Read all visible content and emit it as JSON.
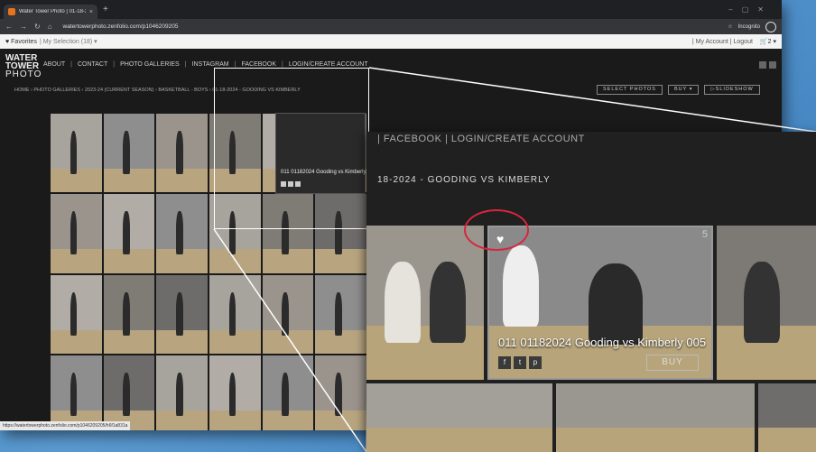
{
  "browser": {
    "tab_title": "Water Tower Photo | 01-18-2",
    "url": "watertowerphoto.zenfolio.com/p1046209205",
    "incognito_label": "Incognito",
    "new_tab": "+",
    "close": "×"
  },
  "favbar": {
    "label": "Favorites",
    "selection": "| My Selection (18) ▾",
    "account": "| My Account | Logout",
    "cart": "🛒2 ▾"
  },
  "site": {
    "logo": [
      "WATER",
      "TOWER",
      "PHOTO"
    ],
    "nav": [
      "ABOUT",
      "|",
      "CONTACT",
      "|",
      "PHOTO GALLERIES",
      "|",
      "INSTAGRAM",
      "|",
      "FACEBOOK",
      "|",
      "LOGIN/CREATE ACCOUNT"
    ],
    "breadcrumb": "HOME › PHOTO GALLERIES › 2023-24 (CURRENT SEASON) › BASKETBALL - BOYS › 01-18-2024 - GOODING VS KIMBERLY",
    "select_photos": "SELECT PHOTOS",
    "buy": "BUY ▾",
    "slideshow": "▷SLIDESHOW",
    "status_url": "https://watertowerphoto.zenfolio.com/p1046209205/h6f1a831a"
  },
  "hover": {
    "caption": "011 01182024 Gooding vs Kimberly",
    "icons": [
      "f",
      "t",
      "p"
    ]
  },
  "zoom": {
    "nav": "| FACEBOOK | LOGIN/CREATE ACCOUNT",
    "title": "18-2024 - GOODING VS KIMBERLY",
    "caption": "011 01182024 Gooding vs Kimberly 005",
    "buy": "BUY",
    "number": "5",
    "icons": [
      "f",
      "t",
      "p"
    ],
    "heart": "♥"
  },
  "colors": {
    "highlight": "#d7263d"
  }
}
